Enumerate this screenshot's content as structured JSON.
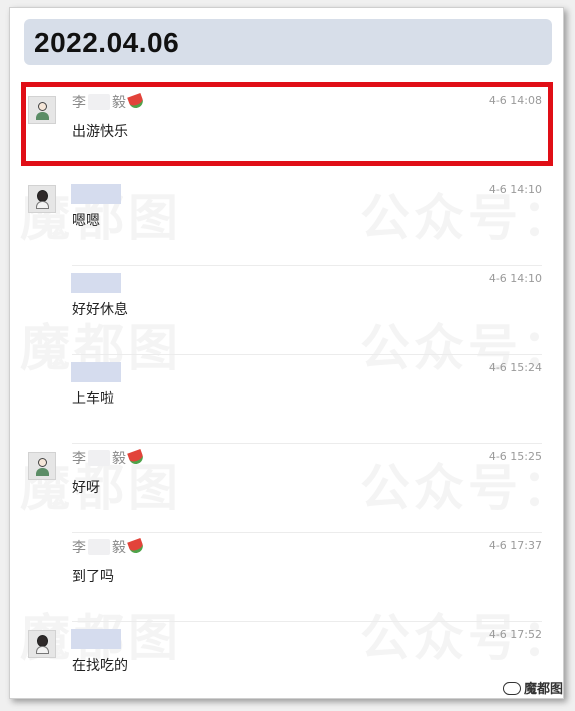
{
  "header": {
    "date": "2022.04.06"
  },
  "watermarks": [
    "魔都图",
    "公众号：",
    "魔都图",
    "公众号：",
    "魔都图",
    "公众号：",
    "魔都图",
    "公众号："
  ],
  "messages": [
    {
      "sender": "李",
      "sender_end": "毅",
      "avatar": "male",
      "time": "4-6 14:08",
      "text": "出游快乐",
      "highlighted": true
    },
    {
      "sender": "",
      "avatar": "female",
      "time": "4-6 14:10",
      "text": "嗯嗯"
    },
    {
      "sender": "",
      "avatar": "none",
      "time": "4-6 14:10",
      "text": "好好休息"
    },
    {
      "sender": "",
      "avatar": "none",
      "time": "4-6 15:24",
      "text": "上车啦"
    },
    {
      "sender": "李",
      "sender_end": "毅",
      "avatar": "male",
      "time": "4-6 15:25",
      "text": "好呀"
    },
    {
      "sender": "李",
      "sender_end": "毅",
      "avatar": "none",
      "time": "4-6 17:37",
      "text": "到了吗"
    },
    {
      "sender": "",
      "avatar": "female",
      "time": "4-6 17:52",
      "text": "在找吃的"
    }
  ],
  "footer": {
    "credit": "魔都图"
  },
  "colors": {
    "highlight": "#e00e16",
    "date_bar": "#d7dee9",
    "name_blur": "#d5dcee"
  }
}
